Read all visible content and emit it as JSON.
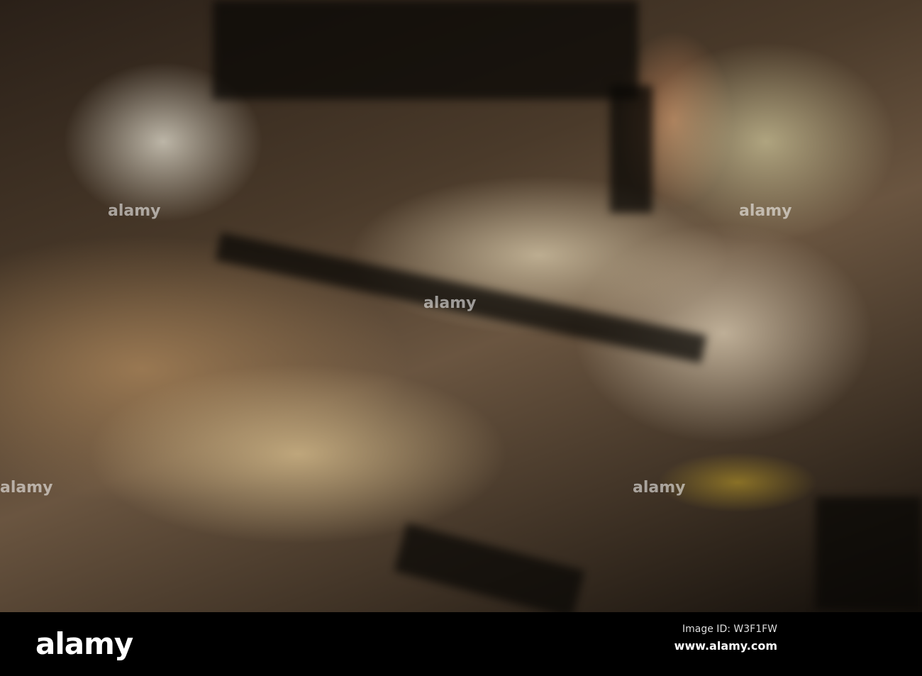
{
  "watermark": {
    "text": "alamy"
  },
  "footer": {
    "logo": "alamy",
    "image_id": "Image ID: W3F1FW",
    "url": "www.alamy.com"
  }
}
